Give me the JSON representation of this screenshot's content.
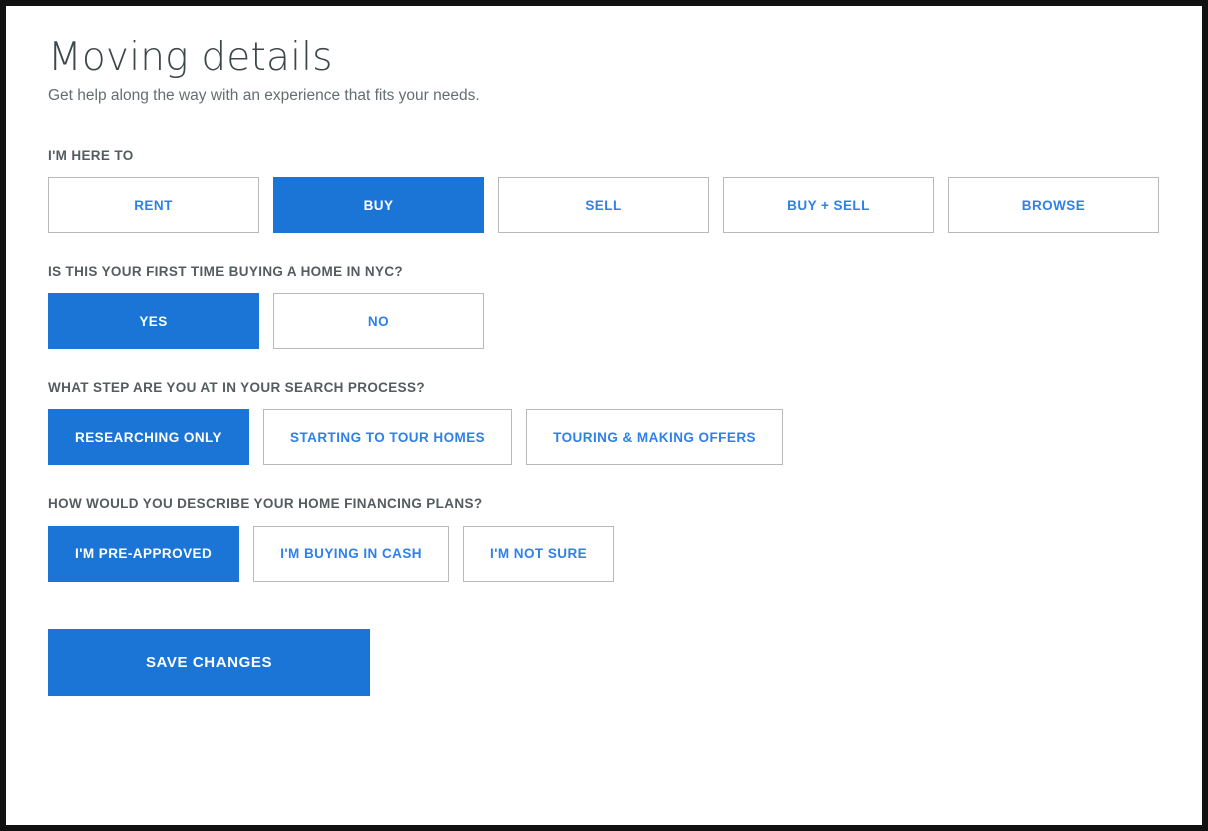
{
  "theme": {
    "accent_blue": "#1a75d6",
    "link_blue": "#2f80e8",
    "label_gray": "#555c5f",
    "title_gray": "#3e4649",
    "subtitle_gray": "#666d70",
    "border_gray": "#b9b9b9",
    "frame_black": "#111111",
    "background_white": "#ffffff"
  },
  "header": {
    "title": "Moving details",
    "subtitle": "Get help along the way with an experience that fits your needs."
  },
  "groups": [
    {
      "id": "here-to",
      "label": "I'M HERE TO",
      "layout": "grid5",
      "options": [
        {
          "label": "RENT",
          "selected": false
        },
        {
          "label": "BUY",
          "selected": true
        },
        {
          "label": "SELL",
          "selected": false
        },
        {
          "label": "BUY + SELL",
          "selected": false
        },
        {
          "label": "BROWSE",
          "selected": false
        }
      ]
    },
    {
      "id": "first-time-buyer",
      "label": "IS THIS YOUR FIRST TIME BUYING A HOME IN NYC?",
      "layout": "grid5",
      "options": [
        {
          "label": "YES",
          "selected": true
        },
        {
          "label": "NO",
          "selected": false
        }
      ]
    },
    {
      "id": "search-step",
      "label": "WHAT STEP ARE YOU AT IN YOUR SEARCH PROCESS?",
      "layout": "auto",
      "options": [
        {
          "label": "RESEARCHING ONLY",
          "selected": true
        },
        {
          "label": "STARTING TO TOUR HOMES",
          "selected": false
        },
        {
          "label": "TOURING & MAKING OFFERS",
          "selected": false
        }
      ]
    },
    {
      "id": "financing-plans",
      "label": "HOW WOULD YOU DESCRIBE YOUR HOME FINANCING PLANS?",
      "layout": "auto",
      "options": [
        {
          "label": "I'M PRE-APPROVED",
          "selected": true
        },
        {
          "label": "I'M BUYING IN CASH",
          "selected": false
        },
        {
          "label": "I'M NOT SURE",
          "selected": false
        }
      ]
    }
  ],
  "footer": {
    "save_label": "SAVE CHANGES"
  }
}
